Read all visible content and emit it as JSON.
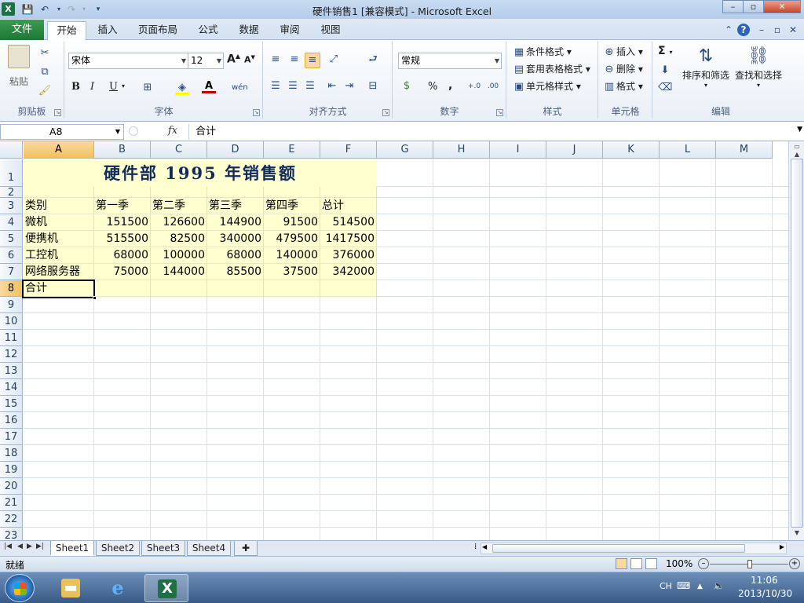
{
  "window": {
    "title": "硬件销售1 [兼容模式] - Microsoft Excel",
    "app_icon": "X",
    "controls": [
      "–",
      "▫",
      "✕"
    ]
  },
  "ribbon_tabs": {
    "file": "文件",
    "tabs": [
      "开始",
      "插入",
      "页面布局",
      "公式",
      "数据",
      "审阅",
      "视图"
    ],
    "active_tab": "开始"
  },
  "ribbon": {
    "clipboard": {
      "label": "剪贴板",
      "paste": "粘贴"
    },
    "font": {
      "label": "字体",
      "font_name": "宋体",
      "font_size": "12",
      "bold": "B",
      "italic": "I",
      "underline": "U"
    },
    "alignment": {
      "label": "对齐方式"
    },
    "number": {
      "label": "数字",
      "format": "常规",
      "percent": "%",
      "comma": ","
    },
    "styles": {
      "label": "样式",
      "conditional": "条件格式",
      "table": "套用表格格式",
      "cell_styles": "单元格样式"
    },
    "cells": {
      "label": "单元格",
      "insert": "插入",
      "delete": "删除",
      "format": "格式"
    },
    "editing": {
      "label": "编辑",
      "sort_filter": "排序和筛选",
      "find_select": "查找和选择",
      "sigma": "Σ"
    }
  },
  "formula_bar": {
    "name_box": "A8",
    "fx": "fx",
    "content": "合计"
  },
  "columns": [
    "A",
    "B",
    "C",
    "D",
    "E",
    "F",
    "G",
    "H",
    "I",
    "J",
    "K",
    "L",
    "M"
  ],
  "rows": [
    "1",
    "2",
    "3",
    "4",
    "5",
    "6",
    "7",
    "8",
    "9",
    "10",
    "11",
    "12",
    "13",
    "14",
    "15",
    "16",
    "17",
    "18",
    "19",
    "20",
    "21",
    "22",
    "23"
  ],
  "selected_cell": {
    "column": "A",
    "row": "8"
  },
  "sheet": {
    "title": "硬件部 1995 年销售额",
    "headers": [
      "类别",
      "第一季",
      "第二季",
      "第三季",
      "第四季",
      "总计"
    ],
    "data": [
      [
        "微机",
        "151500",
        "126600",
        "144900",
        "91500",
        "514500"
      ],
      [
        "便携机",
        "515500",
        "82500",
        "340000",
        "479500",
        "1417500"
      ],
      [
        "工控机",
        "68000",
        "100000",
        "68000",
        "140000",
        "376000"
      ],
      [
        "网络服务器",
        "75000",
        "144000",
        "85500",
        "37500",
        "342000"
      ]
    ],
    "total_label": "合计",
    "highlight_color": "#ffffcf"
  },
  "sheet_tabs": [
    "Sheet1",
    "Sheet2",
    "Sheet3",
    "Sheet4"
  ],
  "active_sheet": "Sheet1",
  "status_bar": {
    "text": "就绪",
    "zoom": "100%"
  },
  "taskbar": {
    "lang": "CH",
    "time": "11:06",
    "date": "2013/10/30"
  },
  "colors": {
    "excel_green": "#1e7145",
    "file_tab": "#2a8a45",
    "selection_header": "#f1c15f"
  }
}
